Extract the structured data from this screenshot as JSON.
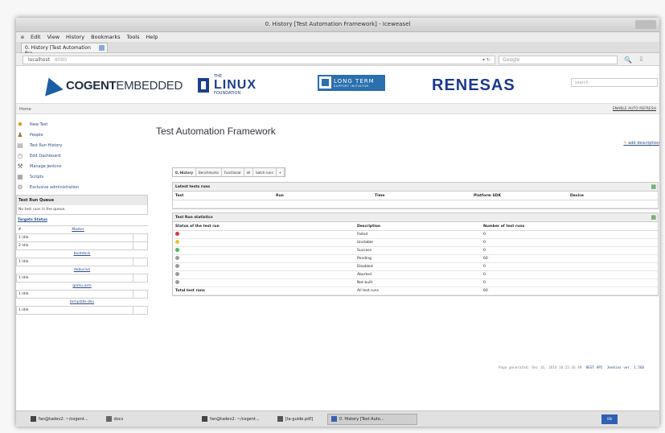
{
  "browser": {
    "window_title": "0. History [Test Automation Framework] - Iceweasel",
    "menu": [
      "e",
      "Edit",
      "View",
      "History",
      "Bookmarks",
      "Tools",
      "Help"
    ],
    "tab_label": "0. History [Test Automation Fra...",
    "url": "localhost",
    "url_port": ":8080",
    "search_placeholder": "Google"
  },
  "logos": {
    "cogent": "COGENT",
    "cogent_suffix": "EMBEDDED",
    "linux_the": "THE",
    "linux": "LINUX",
    "linux_foundation": "FOUNDATION",
    "ltsi": "LONG TERM",
    "ltsi_sub": "SUPPORT INITIATIVE",
    "renesas": "RENESAS"
  },
  "jenkins": {
    "search_placeholder": "search",
    "breadcrumb": "Home",
    "auto_refresh": "ENABLE AUTO REFRESH",
    "page_title": "Test Automation Framework",
    "add_description": "add description"
  },
  "sidebar": {
    "tasks": [
      {
        "label": "New Test",
        "icon": "new-icon"
      },
      {
        "label": "People",
        "icon": "people-icon"
      },
      {
        "label": "Test Run History",
        "icon": "history-icon"
      },
      {
        "label": "Edit Dashboard",
        "icon": "edit-icon"
      },
      {
        "label": "Manage Jenkins",
        "icon": "manage-icon"
      },
      {
        "label": "Scripts",
        "icon": "script-icon"
      },
      {
        "label": "Exclusive administration",
        "icon": "admin-icon"
      }
    ],
    "queue_header": "Test Run Queue",
    "queue_empty": "No test runs in the queue.",
    "executor_header": "Targets Status",
    "executor_col_num": "#",
    "nodes": [
      {
        "name": "Master",
        "rows": [
          "1 Idle",
          "2 Idle"
        ]
      },
      {
        "name": "bootdock",
        "rows": [
          "1 Idle"
        ]
      },
      {
        "name": "debusive",
        "rows": [
          "1 Idle"
        ]
      },
      {
        "name": "qemu-arm",
        "rows": [
          "1 Idle"
        ]
      },
      {
        "name": "template-dev",
        "rows": [
          "1 Idle"
        ]
      }
    ]
  },
  "views": [
    "0. History",
    "Benchmarks",
    "Functional",
    "all",
    "batch runs",
    "+"
  ],
  "latest_runs": {
    "title": "Latest tests runs",
    "columns": [
      "Test",
      "Run",
      "Time",
      "Platform SDK",
      "Device"
    ]
  },
  "stats": {
    "title": "Test Run statistics",
    "columns": [
      "Status of the test run",
      "Description",
      "Number of test runs"
    ],
    "rows": [
      {
        "color": "#d83a3a",
        "description": "Failed",
        "count": "0"
      },
      {
        "color": "#e8c43a",
        "description": "Unstable",
        "count": "0"
      },
      {
        "color": "#4fb84f",
        "description": "Success",
        "count": "0"
      },
      {
        "color": "#9a9a9a",
        "description": "Pending",
        "count": "60"
      },
      {
        "color": "#9a9a9a",
        "description": "Disabled",
        "count": "0"
      },
      {
        "color": "#9a9a9a",
        "description": "Aborted",
        "count": "0"
      },
      {
        "color": "#9a9a9a",
        "description": "Not built",
        "count": "0"
      }
    ],
    "total_label": "Total test runs",
    "total_desc": "All test runs",
    "total_count": "60"
  },
  "footer": {
    "generated": "Page generated: Dec 16, 2014 10:25:36 AM",
    "rest_api": "REST API",
    "version": "Jenkins ver. 1.566"
  },
  "taskbar": {
    "items": [
      "fan@tadev2: ~/cogent...",
      "docs",
      "fan@tadev2: ~/cogent...",
      "[ta-guide.pdf]",
      "0. History [Test Auto..."
    ],
    "tray": "EN"
  }
}
